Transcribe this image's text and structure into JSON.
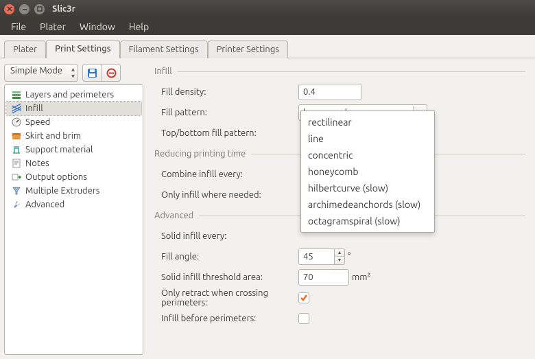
{
  "window": {
    "title": "Slic3r"
  },
  "menu": {
    "file": "File",
    "plater": "Plater",
    "window": "Window",
    "help": "Help"
  },
  "tabs": {
    "plater": "Plater",
    "print": "Print Settings",
    "filament": "Filament Settings",
    "printer": "Printer Settings",
    "active": "print"
  },
  "toolbar": {
    "mode": "Simple Mode"
  },
  "tree": {
    "items": [
      {
        "label": "Layers and perimeters",
        "icon": "layers"
      },
      {
        "label": "Infill",
        "icon": "infill"
      },
      {
        "label": "Speed",
        "icon": "speed"
      },
      {
        "label": "Skirt and brim",
        "icon": "skirt"
      },
      {
        "label": "Support material",
        "icon": "support"
      },
      {
        "label": "Notes",
        "icon": "notes"
      },
      {
        "label": "Output options",
        "icon": "output"
      },
      {
        "label": "Multiple Extruders",
        "icon": "funnel"
      },
      {
        "label": "Advanced",
        "icon": "wrench"
      }
    ],
    "selected": 1
  },
  "sections": {
    "infill": {
      "legend": "Infill",
      "fill_density_label": "Fill density:",
      "fill_density_value": "0.4",
      "fill_pattern_label": "Fill pattern:",
      "fill_pattern_value": "honeycomb",
      "fill_pattern_options": [
        "rectilinear",
        "line",
        "concentric",
        "honeycomb",
        "hilbertcurve (slow)",
        "archimedeanchords (slow)",
        "octagramspiral (slow)"
      ],
      "top_bottom_label": "Top/bottom fill pattern:"
    },
    "reducing": {
      "legend": "Reducing printing time",
      "combine_label": "Combine infill every:",
      "only_where_label": "Only infill where needed:"
    },
    "advanced": {
      "legend": "Advanced",
      "solid_every_label": "Solid infill every:",
      "fill_angle_label": "Fill angle:",
      "fill_angle_value": "45",
      "fill_angle_unit": "°",
      "threshold_label": "Solid infill threshold area:",
      "threshold_value": "70",
      "threshold_unit": "mm²",
      "only_retract_label": "Only retract when crossing perimeters:",
      "only_retract_checked": true,
      "infill_before_label": "Infill before perimeters:",
      "infill_before_checked": false
    }
  }
}
